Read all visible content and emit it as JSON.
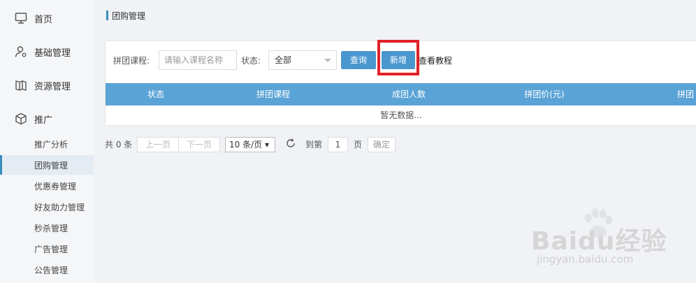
{
  "sidebar": {
    "items": [
      {
        "label": "首页",
        "icon": "monitor-icon"
      },
      {
        "label": "基础管理",
        "icon": "user-gear-icon"
      },
      {
        "label": "资源管理",
        "icon": "book-icon"
      },
      {
        "label": "推广",
        "icon": "cube-icon"
      }
    ],
    "sub_items": [
      {
        "label": "推广分析"
      },
      {
        "label": "团购管理"
      },
      {
        "label": "优惠券管理"
      },
      {
        "label": "好友助力管理"
      },
      {
        "label": "秒杀管理"
      },
      {
        "label": "广告管理"
      },
      {
        "label": "公告管理"
      }
    ],
    "active_sub": "团购管理"
  },
  "page": {
    "title": "团购管理"
  },
  "filter": {
    "course_label": "拼团课程:",
    "course_placeholder": "请输入课程名称",
    "status_label": "状态:",
    "status_value": "全部",
    "query_button": "查询",
    "add_button": "新增",
    "tutorial_link": "查看教程"
  },
  "table": {
    "columns": [
      "状态",
      "拼团课程",
      "成团人数",
      "拼团价(元)",
      "拼团"
    ],
    "empty_text": "暂无数据..."
  },
  "pager": {
    "total_text": "共 0 条",
    "prev": "上一页",
    "next": "下一页",
    "page_size": "10 条/页 ▾",
    "goto_label": "到第",
    "page_value": "1",
    "page_unit": "页",
    "confirm": "确定"
  },
  "watermark": {
    "brand": "Baidu经验",
    "url": "jingyan.baidu.com"
  },
  "colors": {
    "accent": "#4a97cf",
    "table_header": "#5aa3d6",
    "highlight_box": "#e12227"
  }
}
